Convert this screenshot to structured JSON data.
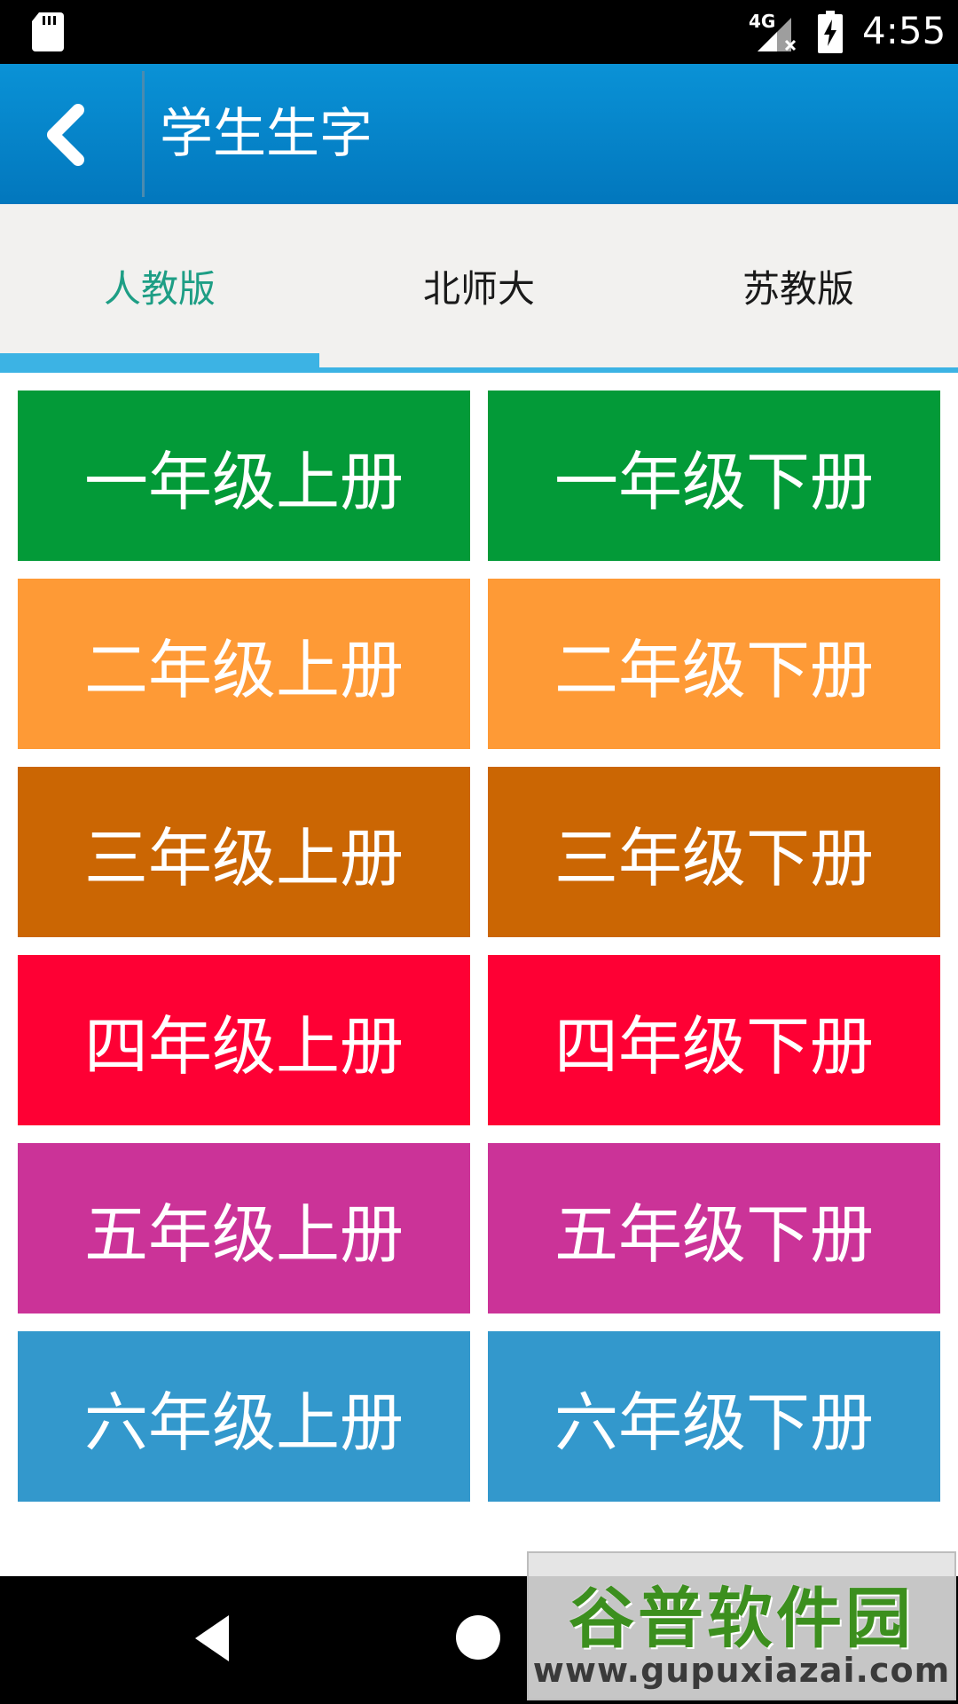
{
  "status_bar": {
    "network": "4G",
    "time": "4:55",
    "icons": [
      "sd-card-icon",
      "signal-icon",
      "battery-charging-icon"
    ]
  },
  "app_bar": {
    "title": "学生生字",
    "back_icon": "chevron-left-icon",
    "color": "#0288d1"
  },
  "tabs": [
    {
      "label": "人教版",
      "active": true
    },
    {
      "label": "北师大",
      "active": false
    },
    {
      "label": "苏教版",
      "active": false
    }
  ],
  "tab_accent_color": "#3cb3e4",
  "tab_active_text_color": "#1e9e85",
  "grades": [
    {
      "upper": "一年级上册",
      "lower": "一年级下册",
      "color": "#039a38"
    },
    {
      "upper": "二年级上册",
      "lower": "二年级下册",
      "color": "#fe9a36"
    },
    {
      "upper": "三年级上册",
      "lower": "三年级下册",
      "color": "#cb6603"
    },
    {
      "upper": "四年级上册",
      "lower": "四年级下册",
      "color": "#fe0034"
    },
    {
      "upper": "五年级上册",
      "lower": "五年级下册",
      "color": "#cb3398"
    },
    {
      "upper": "六年级上册",
      "lower": "六年级下册",
      "color": "#3398cc"
    }
  ],
  "nav_bar": {
    "icons": [
      "back-triangle-icon",
      "home-circle-icon"
    ]
  },
  "watermark": {
    "brand": "谷普软件园",
    "url": "www.gupuxiazai.com"
  }
}
